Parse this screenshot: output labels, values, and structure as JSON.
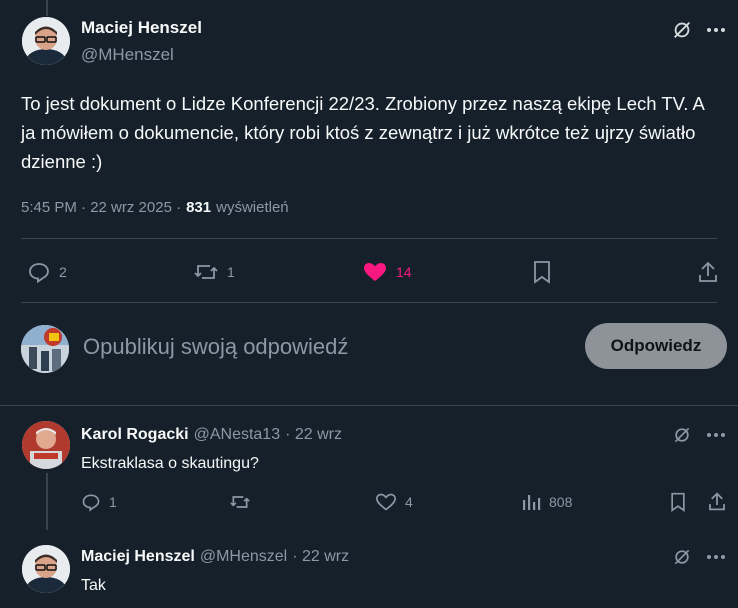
{
  "main_tweet": {
    "author_name": "Maciej Henszel",
    "handle": "@MHenszel",
    "text": "To jest dokument o Lidze Konferencji 22/23. Zrobiony przez naszą ekipę Lech TV. A ja mówiłem o dokumencie, który robi ktoś z zewnątrz i już wkrótce też ujrzy światło dzienne :)",
    "meta_time": "5:45 PM · 22 wrz 2025 ·",
    "views_count": "831",
    "views_label": "wyświetleń",
    "actions": {
      "replies": "2",
      "retweets": "1",
      "likes": "14"
    }
  },
  "composer": {
    "placeholder": "Opublikuj swoją odpowiedź",
    "button_label": "Odpowiedz"
  },
  "replies": [
    {
      "author_name": "Karol Rogacki",
      "handle": "@ANesta13",
      "date": "· 22 wrz",
      "text": "Ekstraklasa o skautingu?",
      "actions": {
        "replies": "1",
        "likes": "4",
        "views": "808"
      }
    },
    {
      "author_name": "Maciej Henszel",
      "handle": "@MHenszel",
      "date": "· 22 wrz",
      "text": "Tak"
    }
  ],
  "colors": {
    "background": "#15202b",
    "like_active": "#f91880",
    "muted": "#8b98a5",
    "divider": "#38444d"
  }
}
